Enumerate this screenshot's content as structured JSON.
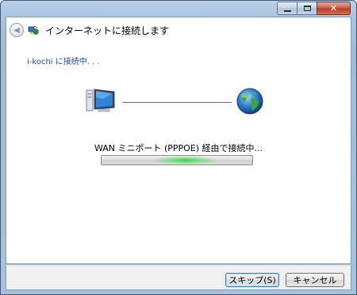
{
  "window": {
    "title": "インターネットに接続します",
    "controls": {
      "minimize": "",
      "maximize": "",
      "close": "✕"
    }
  },
  "status": {
    "connecting_to": "i-kochi に接続中. . ."
  },
  "progress": {
    "label": "WAN ミニポート (PPPOE) 経由で接続中...",
    "indeterminate_glow_position": 0.55
  },
  "buttons": {
    "skip": "スキップ(S)",
    "cancel": "キャンセル"
  },
  "icons": {
    "back": "back-arrow-icon",
    "app": "network-connection-icon",
    "computer": "computer-icon",
    "internet": "globe-icon"
  },
  "colors": {
    "title_bar": "#a9c4df",
    "status_link": "#1a4f9c",
    "progress_green": "#2ad73a",
    "close_button": "#cc5a44"
  }
}
